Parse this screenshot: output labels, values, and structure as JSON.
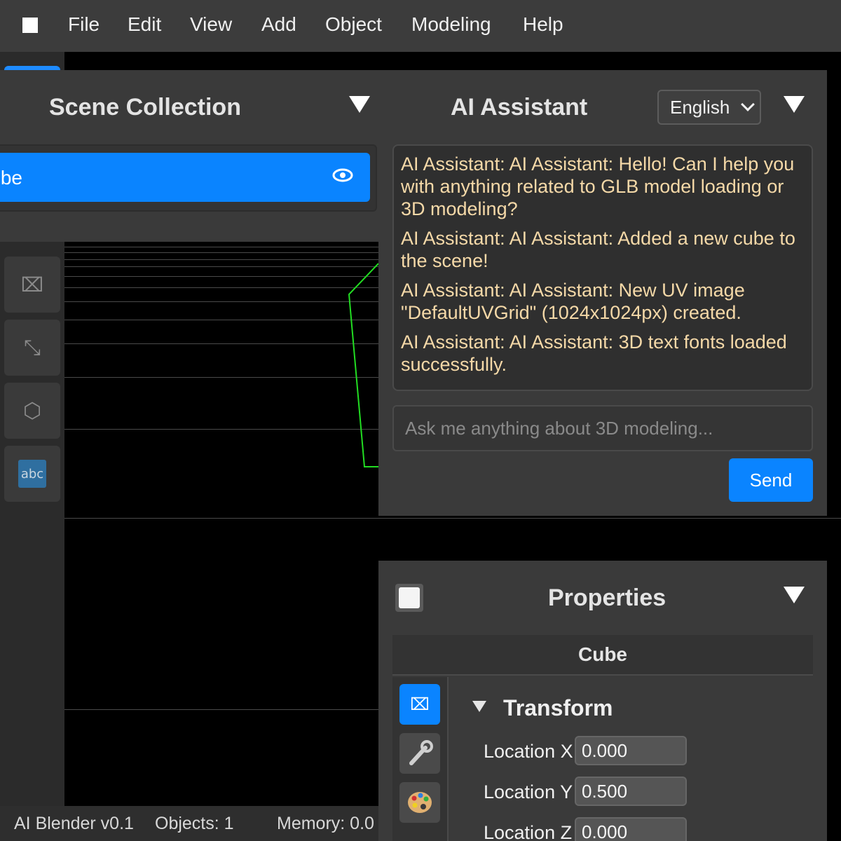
{
  "menubar": {
    "items": [
      "File",
      "Edit",
      "View",
      "Add",
      "Object",
      "Modeling",
      "Help"
    ]
  },
  "scene_collection": {
    "title": "Scene Collection",
    "selected_item": "Cube"
  },
  "ai_assistant": {
    "title": "AI Assistant",
    "language": "English",
    "messages": [
      "AI Assistant: AI Assistant: Hello! Can I help you with anything related to GLB model loading or 3D modeling?",
      "AI Assistant: AI Assistant: Added a new cube to the scene!",
      "AI Assistant: AI Assistant: New UV image \"DefaultUVGrid\" (1024x1024px) created.",
      "AI Assistant: AI Assistant: 3D text fonts loaded successfully."
    ],
    "input_placeholder": "Ask me anything about 3D modeling...",
    "send_label": "Send"
  },
  "properties": {
    "title": "Properties",
    "object_name": "Cube",
    "section_title": "Transform",
    "fields": [
      {
        "label": "Location X",
        "value": "0.000"
      },
      {
        "label": "Location Y",
        "value": "0.500"
      },
      {
        "label": "Location Z",
        "value": "0.000"
      }
    ]
  },
  "statusbar": {
    "app": "AI Blender v0.1",
    "objects": "Objects: 1",
    "memory": "Memory: 0.0"
  },
  "colors": {
    "accent": "#0a84ff",
    "panel": "#3a3a3a",
    "chat_text": "#f5d9a8",
    "wireframe": "#22dd22"
  }
}
